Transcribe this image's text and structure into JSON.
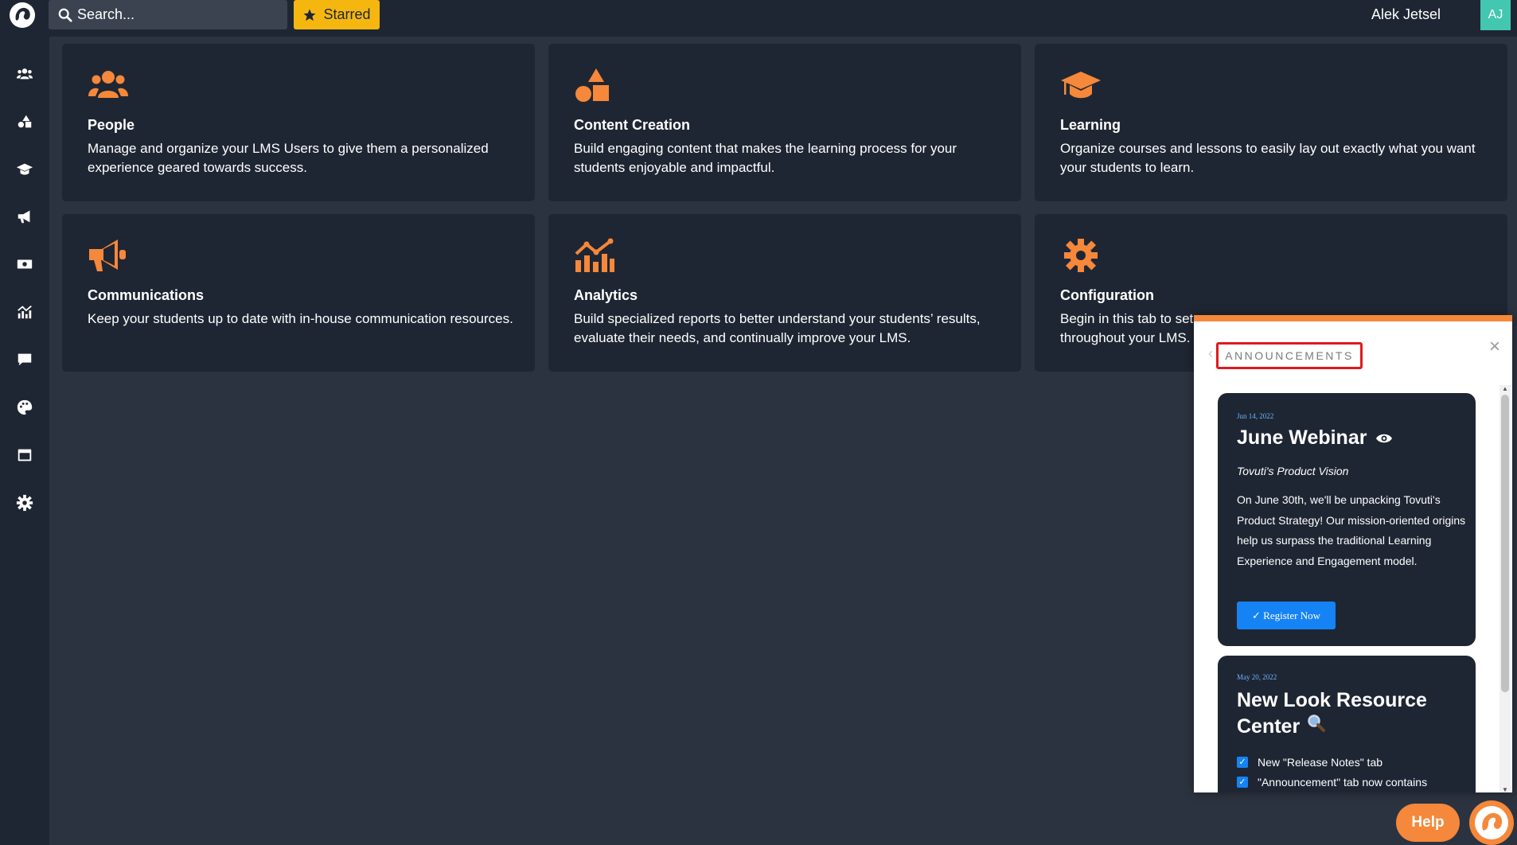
{
  "search": {
    "placeholder": "Search..."
  },
  "starred": {
    "label": "Starred"
  },
  "user": {
    "name": "Alek Jetsel",
    "initials": "AJ"
  },
  "colors": {
    "accent": "#f5883a",
    "starred": "#f5b70f",
    "link": "#1683f5",
    "avatar": "#43c7b0",
    "highlight": "#e0191f"
  },
  "sidebar": {
    "items": [
      {
        "icon": "users-icon"
      },
      {
        "icon": "shapes-icon"
      },
      {
        "icon": "graduation-cap-icon"
      },
      {
        "icon": "megaphone-icon"
      },
      {
        "icon": "money-icon"
      },
      {
        "icon": "chart-icon"
      },
      {
        "icon": "comment-icon"
      },
      {
        "icon": "palette-icon"
      },
      {
        "icon": "window-icon"
      },
      {
        "icon": "gear-icon"
      }
    ]
  },
  "cards": [
    {
      "icon": "users-icon",
      "title": "People",
      "desc": "Manage and organize your LMS Users to give them a personalized experience geared towards success."
    },
    {
      "icon": "shapes-icon",
      "title": "Content Creation",
      "desc": "Build engaging content that makes the learning process for your students enjoyable and impactful."
    },
    {
      "icon": "graduation-cap-icon",
      "title": "Learning",
      "desc": "Organize courses and lessons to easily lay out exactly what you want your students to learn."
    },
    {
      "icon": "megaphone-icon",
      "title": "Communications",
      "desc": "Keep your students up to date with in-house communication resources."
    },
    {
      "icon": "chart-icon",
      "title": "Analytics",
      "desc": "Build specialized reports to better understand your students’ results, evaluate their needs, and continually improve your LMS."
    },
    {
      "icon": "gear-icon",
      "title": "Configuration",
      "desc": "Begin in this tab to set",
      "desc2": "throughout your LMS."
    }
  ],
  "announcements": {
    "title": "ANNOUNCEMENTS",
    "close": "×",
    "items": [
      {
        "date": "Jun 14, 2022",
        "title": "June Webinar",
        "subtitle": "Tovuti's Product Vision",
        "body": "On June 30th, we'll be unpacking Tovuti's Product Strategy! Our mission-oriented origins help us surpass the traditional Learning Experience and Engagement model.",
        "button": "✓ Register Now"
      },
      {
        "date": "May 20, 2022",
        "title_line1": "New Look Resource",
        "title_line2": "Center",
        "checks": [
          "New \"Release Notes\" tab",
          "\"Announcement\" tab now contains"
        ]
      }
    ]
  },
  "help": {
    "label": "Help"
  }
}
